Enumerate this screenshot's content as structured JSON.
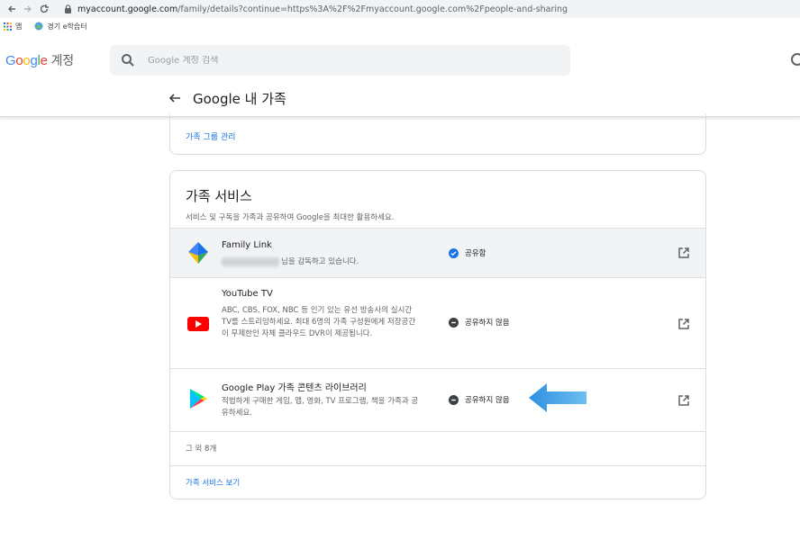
{
  "browser": {
    "url_host": "myaccount.google.com",
    "url_rest": "/family/details?continue=https%3A%2F%2Fmyaccount.google.com%2Fpeople-and-sharing",
    "bookmarks": [
      {
        "label": "앱",
        "icon": "apps-grid-icon"
      },
      {
        "label": "경기 e학습터",
        "icon": "site-favicon"
      }
    ]
  },
  "header": {
    "logo_text": "Google",
    "account_label": "계정",
    "search_placeholder": "Google 계정 검색"
  },
  "subheader": {
    "title": "Google 내 가족"
  },
  "top_card": {
    "link": "가족 그룹 관리"
  },
  "family_services": {
    "title": "가족 서비스",
    "subtitle": "서비스 및 구독을 가족과 공유하여 Google을 최대한 활용하세요.",
    "items": [
      {
        "name": "Family Link",
        "desc_suffix": "님을 감독하고 있습니다.",
        "status": "공유함",
        "status_type": "shared",
        "icon": "family-link-icon"
      },
      {
        "name": "YouTube TV",
        "desc": "ABC, CBS, FOX, NBC 등 인기 있는 유선 방송사의 실시간 TV를 스트리밍하세요. 최대 6명의 가족 구성원에게 저장공간이 무제한인 자체 클라우드 DVR이 제공됩니다.",
        "status": "공유하지 않음",
        "status_type": "not-shared",
        "icon": "youtube-icon"
      },
      {
        "name": "Google Play 가족 콘텐츠 라이브러리",
        "desc": "적법하게 구매한 게임, 앱, 영화, TV 프로그램, 책을 가족과 공유하세요.",
        "status": "공유하지 않음",
        "status_type": "not-shared",
        "icon": "google-play-icon"
      }
    ],
    "more_label": "그 외 8개",
    "view_link": "가족 서비스 보기"
  },
  "colors": {
    "link_blue": "#1a73e8",
    "shared_blue": "#1a73e8",
    "not_shared_gray": "#3c4043",
    "annotation_arrow": "#4aa8e6"
  }
}
